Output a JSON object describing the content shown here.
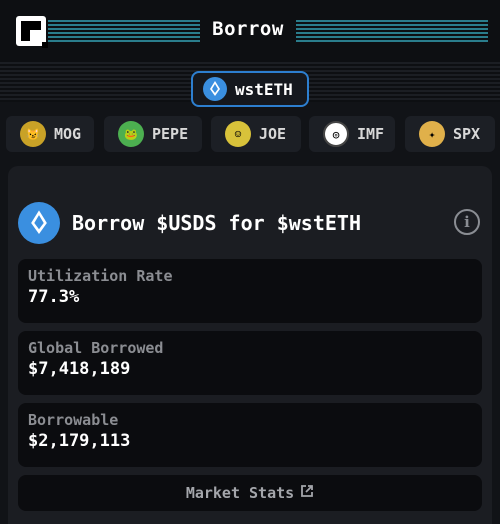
{
  "header": {
    "title": "Borrow"
  },
  "selected_token": {
    "label": "wstETH"
  },
  "tokens": [
    {
      "label": "MOG",
      "icon": "mog-icon",
      "color": "#c9a227"
    },
    {
      "label": "PEPE",
      "icon": "pepe-icon",
      "color": "#4caf50"
    },
    {
      "label": "JOE",
      "icon": "joe-icon",
      "color": "#d8c23a"
    },
    {
      "label": "IMF",
      "icon": "imf-icon",
      "color": "#ffffff"
    },
    {
      "label": "SPX",
      "icon": "spx-icon",
      "color": "#e0b04a"
    }
  ],
  "panel": {
    "title": "Borrow $USDS for $wstETH",
    "stats": [
      {
        "label": "Utilization Rate",
        "value": "77.3%"
      },
      {
        "label": "Global Borrowed",
        "value": "$7,418,189"
      },
      {
        "label": "Borrowable",
        "value": "$2,179,113"
      }
    ],
    "market_stats_label": "Market Stats"
  }
}
